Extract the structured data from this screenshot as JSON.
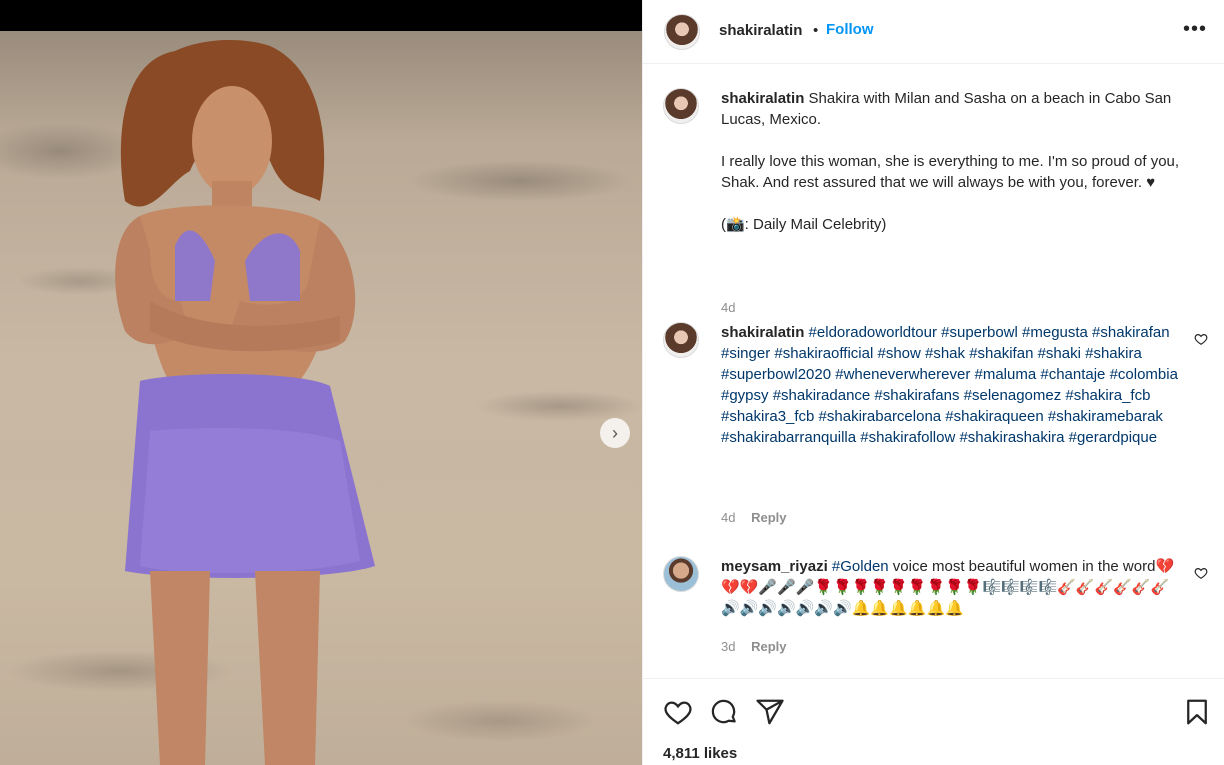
{
  "post": {
    "username": "shakiralatin",
    "follow_label": "Follow",
    "dot": "•",
    "more_icon": "more-horizontal-icon"
  },
  "caption": {
    "username": "shakiralatin",
    "line1": "Shakira with Milan and Sasha on a beach in Cabo San Lucas, Mexico.",
    "line2": "I really love this woman, she is everything to me. I'm so proud of you, Shak. And rest assured that we will always be with you, forever. ♥",
    "line3": "(📸: Daily Mail Celebrity)",
    "time": "4d"
  },
  "comments": [
    {
      "username": "shakiralatin",
      "text": "#eldoradoworldtour #superbowl #megusta #shakirafan #singer #shakiraofficial #show #shak #shakifan #shaki #shakira #superbowl2020 #wheneverwherever #maluma #chantaje #colombia #gypsy #shakiradance #shakirafans #selenagomez #shakira_fcb #shakira3_fcb #shakirabarcelona #shakiraqueen #shakiramebarak #shakirabarranquilla #shakirafollow #shakirashakira #gerardpique",
      "time": "4d",
      "reply_label": "Reply"
    },
    {
      "username": "meysam_riyazi",
      "tag": "#Golden",
      "text": " voice most beautiful women in the word💔💔💔🎤🎤🎤🌹🌹🌹🌹🌹🌹🌹🌹🌹🎼🎼🎼🎼🎸🎸🎸🎸🎸🎸🔊🔊🔊🔊🔊🔊🔊🔔🔔🔔🔔🔔🔔",
      "time": "3d",
      "reply_label": "Reply"
    }
  ],
  "actions": {
    "likes": "4,811 likes"
  },
  "media": {
    "next_glyph": "›"
  }
}
